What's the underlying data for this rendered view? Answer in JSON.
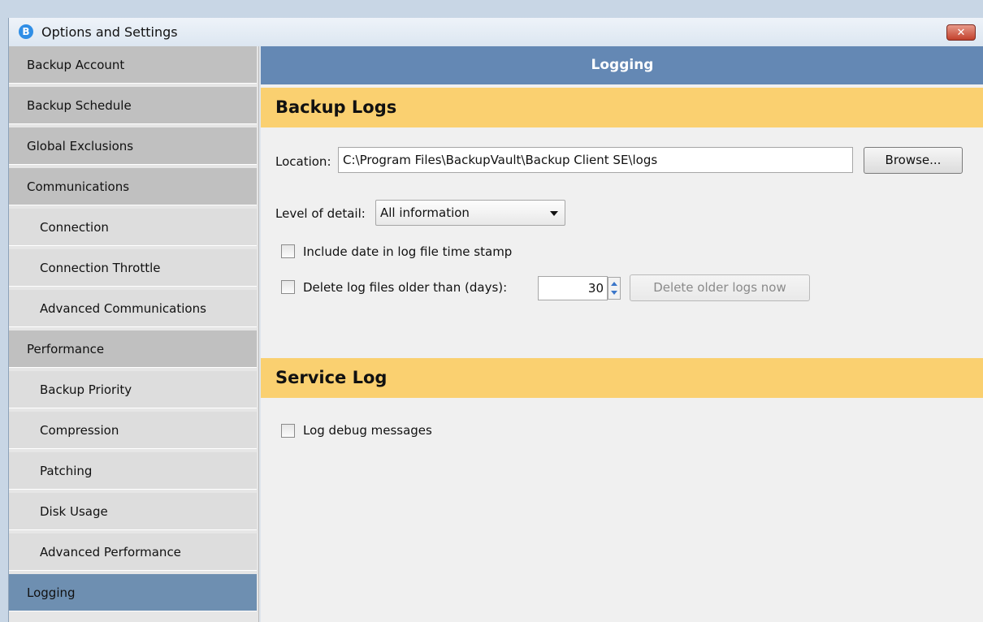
{
  "window": {
    "title": "Options and Settings",
    "close_label": "✕"
  },
  "sidebar": {
    "items": [
      {
        "label": "Backup Account",
        "level": "top"
      },
      {
        "label": "Backup Schedule",
        "level": "top"
      },
      {
        "label": "Global Exclusions",
        "level": "top"
      },
      {
        "label": "Communications",
        "level": "top"
      },
      {
        "label": "Connection",
        "level": "sub"
      },
      {
        "label": "Connection Throttle",
        "level": "sub"
      },
      {
        "label": "Advanced Communications",
        "level": "sub"
      },
      {
        "label": "Performance",
        "level": "top"
      },
      {
        "label": "Backup Priority",
        "level": "sub"
      },
      {
        "label": "Compression",
        "level": "sub"
      },
      {
        "label": "Patching",
        "level": "sub"
      },
      {
        "label": "Disk Usage",
        "level": "sub"
      },
      {
        "label": "Advanced Performance",
        "level": "sub"
      },
      {
        "label": "Logging",
        "level": "active"
      }
    ]
  },
  "main": {
    "header": "Logging",
    "backup_logs": {
      "title": "Backup Logs",
      "location_label": "Location:",
      "location_value": "C:\\Program Files\\BackupVault\\Backup Client SE\\logs",
      "browse_label": "Browse...",
      "detail_label": "Level of detail:",
      "detail_value": "All information",
      "include_date_label": "Include date in log file time stamp",
      "include_date_checked": false,
      "delete_older_label": "Delete log files older than (days):",
      "delete_older_checked": false,
      "days_value": "30",
      "delete_now_label": "Delete older logs now"
    },
    "service_log": {
      "title": "Service Log",
      "debug_label": "Log debug messages",
      "debug_checked": false
    }
  },
  "colors": {
    "header_bg": "#6488b4",
    "section_bg": "#fad070",
    "active_nav": "#6e8fb1"
  }
}
